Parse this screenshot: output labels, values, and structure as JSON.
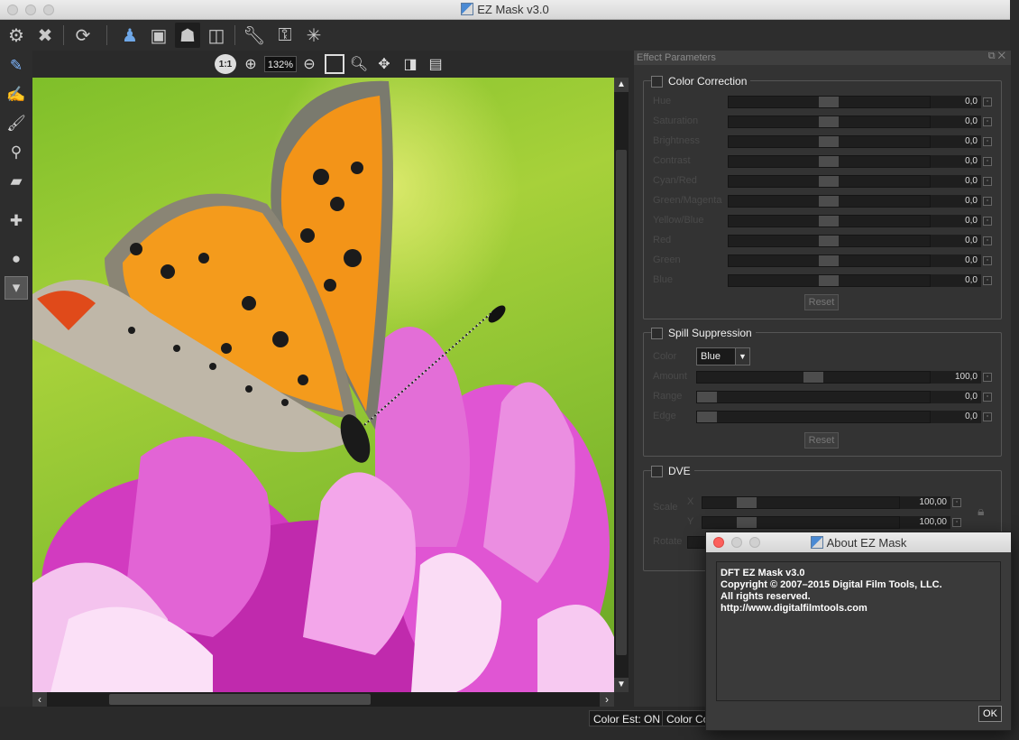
{
  "window": {
    "title": "EZ Mask v3.0"
  },
  "view": {
    "zoom": "132%",
    "fit_label": "1:1"
  },
  "toolbar": {
    "icons": [
      "gear-icon",
      "close-icon",
      "refresh-icon",
      "foreground-person-icon",
      "background-image-icon",
      "subject-icon",
      "compare-icon",
      "wrench-icon",
      "mask-settings-icon",
      "magic-wand-icon"
    ]
  },
  "panel": {
    "title": "Effect Parameters",
    "color_correction": {
      "label": "Color Correction",
      "params": [
        {
          "label": "Hue",
          "value": "0,0"
        },
        {
          "label": "Saturation",
          "value": "0,0"
        },
        {
          "label": "Brightness",
          "value": "0,0"
        },
        {
          "label": "Contrast",
          "value": "0,0"
        },
        {
          "label": "Cyan/Red",
          "value": "0,0"
        },
        {
          "label": "Green/Magenta",
          "value": "0,0"
        },
        {
          "label": "Yellow/Blue",
          "value": "0,0"
        },
        {
          "label": "Red",
          "value": "0,0"
        },
        {
          "label": "Green",
          "value": "0,0"
        },
        {
          "label": "Blue",
          "value": "0,0"
        }
      ],
      "reset": "Reset"
    },
    "spill_suppression": {
      "label": "Spill Suppression",
      "color_label": "Color",
      "color_value": "Blue",
      "params": [
        {
          "label": "Amount",
          "value": "100,0"
        },
        {
          "label": "Range",
          "value": "0,0"
        },
        {
          "label": "Edge",
          "value": "0,0"
        }
      ],
      "reset": "Reset"
    },
    "dve": {
      "label": "DVE",
      "scale_label": "Scale",
      "x_label": "X",
      "y_label": "Y",
      "x_value": "100,00",
      "y_value": "100,00",
      "rotate_label": "Rotate"
    }
  },
  "status": {
    "color_est": "Color Est: ON",
    "color_co": "Color Co"
  },
  "about": {
    "title": "About EZ Mask",
    "lines": [
      "DFT EZ Mask v3.0",
      "Copyright © 2007–2015 Digital Film Tools, LLC.",
      "All rights reserved.",
      "http://www.digitalfilmtools.com"
    ],
    "ok": "OK"
  }
}
